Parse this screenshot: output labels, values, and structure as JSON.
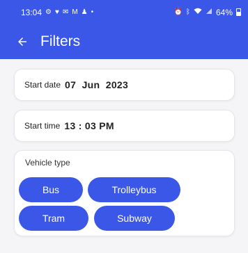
{
  "status_bar": {
    "time": "13:04",
    "left_icons": [
      "settings-icon",
      "heart-icon",
      "mail-icon",
      "gmail-icon",
      "person-icon",
      "dot-icon"
    ],
    "right_icons": [
      "alarm-icon",
      "bluetooth-icon",
      "wifi-icon",
      "signal-icon"
    ],
    "battery": "64%"
  },
  "app_bar": {
    "title": "Filters",
    "back_icon": "arrow-back-icon"
  },
  "date_field": {
    "label": "Start date",
    "value": "07  Jun  2023"
  },
  "time_field": {
    "label": "Start time",
    "value": "13 : 03 PM"
  },
  "vehicle_type": {
    "title": "Vehicle type",
    "options": [
      "Bus",
      "Trolleybus",
      "Tram",
      "Subway"
    ]
  },
  "colors": {
    "primary": "#3a57e8",
    "background": "#f5f5f7",
    "card": "#ffffff"
  }
}
